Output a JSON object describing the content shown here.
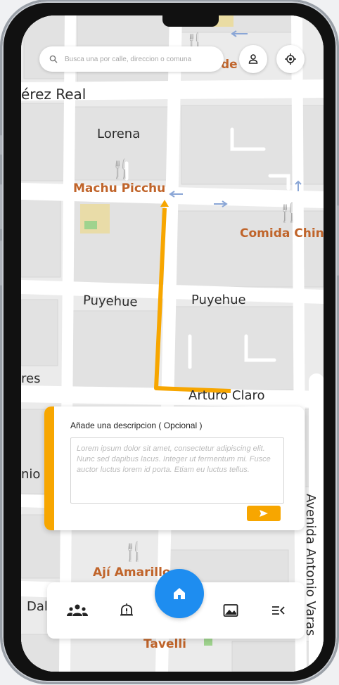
{
  "search": {
    "placeholder": "Busca una por calle, direccion o comuna",
    "icon": "search-icon"
  },
  "top_buttons": {
    "profile_icon": "user-icon",
    "locate_icon": "crosshair-icon"
  },
  "map": {
    "streets": {
      "perez_real": "érez Real",
      "lorena": "Lorena",
      "puyehue_left": "Puyehue",
      "puyehue_right": "Puyehue",
      "arturo_claro": "Arturo Claro",
      "res": "res",
      "nio": "nio",
      "dal": "Dal",
      "avenida": "Avenida Antonio Varas"
    },
    "pois": {
      "top": "de",
      "machu_picchu": "Machu Picchu",
      "comida_china": "Comida Chin",
      "aji_amarillo": "Ají Amarillo",
      "tavelli": "Tavelli"
    },
    "colors": {
      "route": "#f7a600",
      "poi": "#c0642a",
      "road": "#ffffff",
      "block": "#e4e4e4"
    }
  },
  "description_card": {
    "title": "Añade una descripcion ( Opcional )",
    "placeholder": "Lorem ipsum dolor sit amet, consectetur adipiscing elit. Nunc sed dapibus lacus. Integer ut fermentum mi. Fusce auctor luctus lorem id porta. Etiam eu luctus tellus.",
    "send_icon": "send-icon",
    "accent": "#f7a600"
  },
  "bottom_nav": {
    "items": [
      {
        "icon": "community-icon"
      },
      {
        "icon": "alert-icon"
      },
      {
        "icon": "home-icon"
      },
      {
        "icon": "gallery-icon"
      },
      {
        "icon": "list-menu-icon"
      }
    ],
    "home_color": "#1e8df0"
  }
}
